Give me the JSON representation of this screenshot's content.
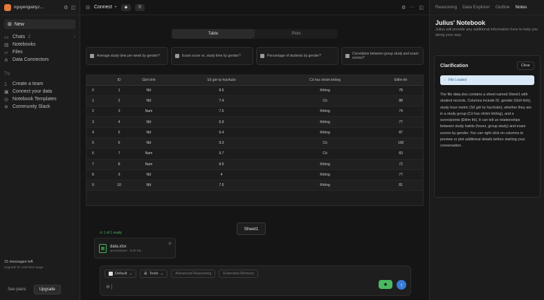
{
  "sidebar": {
    "user": "nguyengiahy2...",
    "new_label": "New",
    "items": [
      {
        "label": "Chats",
        "count": "2"
      },
      {
        "label": "Notebooks"
      },
      {
        "label": "Files"
      },
      {
        "label": "Data Connectors"
      }
    ],
    "section_title": "Try",
    "try_items": [
      {
        "label": "Create a team"
      },
      {
        "label": "Connect your data"
      },
      {
        "label": "Notebook Templates"
      },
      {
        "label": "Community Slack"
      }
    ],
    "messages_left": "15 messages left",
    "messages_sub": "Upgrade for unlimited usage",
    "see_plans": "See plans",
    "upgrade": "Upgrade"
  },
  "topbar": {
    "connect": "Connect"
  },
  "view_tabs": [
    "Table",
    "Plots"
  ],
  "suggestions": [
    "Average study time per week by gender?",
    "Exam score vs. study time by gender?",
    "Percentage of students by gender?",
    "Correlation between group study and exam scores?"
  ],
  "table": {
    "headers": [
      "",
      "ID",
      "Giới tính",
      "Số giờ tự học/tuần",
      "Có học nhóm không",
      "Điểm thi"
    ],
    "rows": [
      [
        "0",
        "1",
        "Nữ",
        "8.6",
        "Không",
        "78"
      ],
      [
        "1",
        "2",
        "Nữ",
        "7.4",
        "Có",
        "88"
      ],
      [
        "2",
        "3",
        "Nam",
        "7.5",
        "Không",
        "74"
      ],
      [
        "3",
        "4",
        "Nữ",
        "6.9",
        "Không",
        "77"
      ],
      [
        "4",
        "5",
        "Nữ",
        "6.4",
        "Không",
        "87"
      ],
      [
        "5",
        "6",
        "Nữ",
        "9.3",
        "Có",
        "100"
      ],
      [
        "6",
        "7",
        "Nam",
        "9.7",
        "Có",
        "83"
      ],
      [
        "7",
        "8",
        "Nam",
        "8.9",
        "Không",
        "72"
      ],
      [
        "8",
        "9",
        "Nữ",
        "4",
        "Không",
        "77"
      ],
      [
        "9",
        "10",
        "Nữ",
        "7.5",
        "Không",
        "81"
      ]
    ]
  },
  "sheet_button": "Sheet1",
  "files_ready": "1 of 1 ready",
  "file": {
    "name": "data.xlsx",
    "meta": "spreadsheet · 9.00 KB"
  },
  "composer": {
    "model": "Default",
    "tools": "Tools",
    "advanced": "Advanced Reasoning",
    "memory": "Extended Memory"
  },
  "right": {
    "tabs": [
      "Reasoning",
      "Data Explorer",
      "Outline",
      "Notes"
    ],
    "active_tab": "Notes",
    "title": "Julius' Notebook",
    "subtitle": "Julius will provide any additional information here to help you along your way.",
    "clar_title": "Clarification",
    "clear": "Clear",
    "loaded": "File Loaded",
    "clar_text": "The file data.xlsx contains a sheet named Sheet1 with student records. Columns include ID, gender (Giới tính), study hour metric (Số giờ tự học/tuần), whether they are in a study group (Có học nhóm không), and a score/points (Điểm thi). It can tell us relationships between study habits (hours, group study) and exam scores by gender. You can right click on columns to preview or plot additional details before starting your conversation."
  },
  "colors": {
    "accent": "#3a7bd5",
    "success": "#4bb861",
    "brand": "#e57b3a"
  }
}
